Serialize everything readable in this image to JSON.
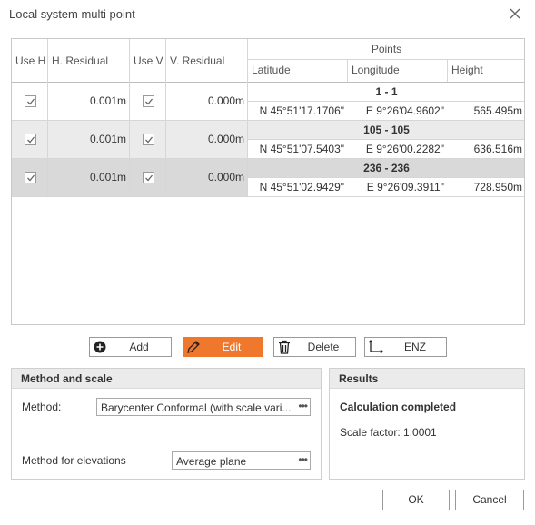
{
  "window": {
    "title": "Local system multi point"
  },
  "table": {
    "columns": {
      "use_h": "Use H",
      "h_residual": "H. Residual",
      "use_v": "Use V",
      "v_residual": "V. Residual",
      "points": "Points",
      "latitude": "Latitude",
      "longitude": "Longitude",
      "height": "Height"
    },
    "rows": [
      {
        "use_h": true,
        "h_residual": "0.001m",
        "use_v": true,
        "v_residual": "0.000m",
        "point": "1 - 1",
        "latitude": "N 45°51'17.1706\"",
        "longitude": "E 9°26'04.9602\"",
        "height": "565.495m"
      },
      {
        "use_h": true,
        "h_residual": "0.001m",
        "use_v": true,
        "v_residual": "0.000m",
        "point": "105 - 105",
        "latitude": "N 45°51'07.5403\"",
        "longitude": "E 9°26'00.2282\"",
        "height": "636.516m"
      },
      {
        "use_h": true,
        "h_residual": "0.001m",
        "use_v": true,
        "v_residual": "0.000m",
        "point": "236 - 236",
        "latitude": "N 45°51'02.9429\"",
        "longitude": "E 9°26'09.3911\"",
        "height": "728.950m"
      }
    ]
  },
  "toolbar": {
    "add": "Add",
    "edit": "Edit",
    "delete": "Delete",
    "enz": "ENZ",
    "accent_color": "#f0782d"
  },
  "method_panel": {
    "title": "Method and scale",
    "method_label": "Method:",
    "method_value": "Barycenter Conformal (with scale vari...",
    "elevations_label": "Method for elevations",
    "elevations_value": "Average plane"
  },
  "results_panel": {
    "title": "Results",
    "status": "Calculation completed",
    "scale_factor": "Scale factor: 1.0001"
  },
  "dialog": {
    "ok": "OK",
    "cancel": "Cancel"
  }
}
